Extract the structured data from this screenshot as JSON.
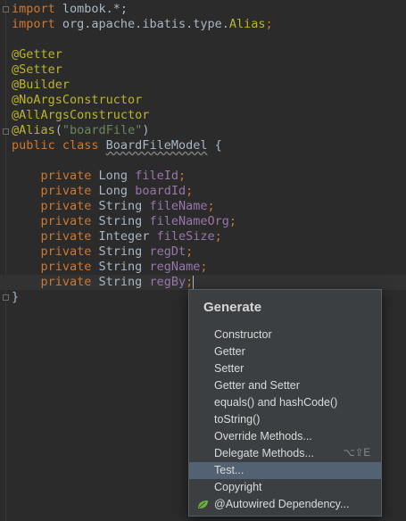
{
  "editor": {
    "lines": [
      [
        {
          "t": "import",
          "c": "kw"
        },
        {
          "t": " lombok.*;",
          "c": "txt"
        }
      ],
      [
        {
          "t": "import",
          "c": "kw"
        },
        {
          "t": " org.apache.ibatis.type.",
          "c": "txt"
        },
        {
          "t": "Alias",
          "c": "ann"
        },
        {
          "t": ";",
          "c": "kw"
        }
      ],
      [],
      [
        {
          "t": "@Getter",
          "c": "ann"
        }
      ],
      [
        {
          "t": "@Setter",
          "c": "ann"
        }
      ],
      [
        {
          "t": "@Builder",
          "c": "ann"
        }
      ],
      [
        {
          "t": "@NoArgsConstructor",
          "c": "ann"
        }
      ],
      [
        {
          "t": "@AllArgsConstructor",
          "c": "ann"
        }
      ],
      [
        {
          "t": "@Alias",
          "c": "ann"
        },
        {
          "t": "(",
          "c": "txt"
        },
        {
          "t": "\"boardFile\"",
          "c": "str"
        },
        {
          "t": ")",
          "c": "txt"
        }
      ],
      [
        {
          "t": "public class ",
          "c": "kw"
        },
        {
          "t": "BoardFileModel",
          "c": "txt squig"
        },
        {
          "t": " {",
          "c": "txt"
        }
      ],
      [],
      [
        {
          "t": "    private ",
          "c": "kw"
        },
        {
          "t": "Long ",
          "c": "txt"
        },
        {
          "t": "fileId",
          "c": "fld"
        },
        {
          "t": ";",
          "c": "kw"
        }
      ],
      [
        {
          "t": "    private ",
          "c": "kw"
        },
        {
          "t": "Long ",
          "c": "txt"
        },
        {
          "t": "boardId",
          "c": "fld"
        },
        {
          "t": ";",
          "c": "kw"
        }
      ],
      [
        {
          "t": "    private ",
          "c": "kw"
        },
        {
          "t": "String ",
          "c": "txt"
        },
        {
          "t": "fileName",
          "c": "fld"
        },
        {
          "t": ";",
          "c": "kw"
        }
      ],
      [
        {
          "t": "    private ",
          "c": "kw"
        },
        {
          "t": "String ",
          "c": "txt"
        },
        {
          "t": "fileNameOrg",
          "c": "fld"
        },
        {
          "t": ";",
          "c": "kw"
        }
      ],
      [
        {
          "t": "    private ",
          "c": "kw"
        },
        {
          "t": "Integer ",
          "c": "txt"
        },
        {
          "t": "fileSize",
          "c": "fld"
        },
        {
          "t": ";",
          "c": "kw"
        }
      ],
      [
        {
          "t": "    private ",
          "c": "kw"
        },
        {
          "t": "String ",
          "c": "txt"
        },
        {
          "t": "regDt",
          "c": "fld"
        },
        {
          "t": ";",
          "c": "kw"
        }
      ],
      [
        {
          "t": "    private ",
          "c": "kw"
        },
        {
          "t": "String ",
          "c": "txt"
        },
        {
          "t": "regName",
          "c": "fld"
        },
        {
          "t": ";",
          "c": "kw"
        }
      ],
      [
        {
          "t": "    private ",
          "c": "kw"
        },
        {
          "t": "String ",
          "c": "txt"
        },
        {
          "t": "regBy",
          "c": "fld"
        },
        {
          "t": ";",
          "c": "kw"
        }
      ],
      [
        {
          "t": "}",
          "c": "txt"
        }
      ]
    ],
    "current_line": 18
  },
  "generate_popup": {
    "title": "Generate",
    "items": [
      {
        "label": "Constructor",
        "shortcut": "",
        "selected": false,
        "icon": ""
      },
      {
        "label": "Getter",
        "shortcut": "",
        "selected": false,
        "icon": ""
      },
      {
        "label": "Setter",
        "shortcut": "",
        "selected": false,
        "icon": ""
      },
      {
        "label": "Getter and Setter",
        "shortcut": "",
        "selected": false,
        "icon": ""
      },
      {
        "label": "equals() and hashCode()",
        "shortcut": "",
        "selected": false,
        "icon": ""
      },
      {
        "label": "toString()",
        "shortcut": "",
        "selected": false,
        "icon": ""
      },
      {
        "label": "Override Methods...",
        "shortcut": "",
        "selected": false,
        "icon": ""
      },
      {
        "label": "Delegate Methods...",
        "shortcut": "⌥⇧E",
        "selected": false,
        "icon": ""
      },
      {
        "label": "Test...",
        "shortcut": "",
        "selected": true,
        "icon": ""
      },
      {
        "label": "Copyright",
        "shortcut": "",
        "selected": false,
        "icon": ""
      },
      {
        "label": "@Autowired Dependency...",
        "shortcut": "",
        "selected": false,
        "icon": "spring-leaf-icon"
      }
    ],
    "colors": {
      "background": "#3c3f41",
      "selected": "#536272",
      "spring_leaf": "#6db33f"
    }
  }
}
